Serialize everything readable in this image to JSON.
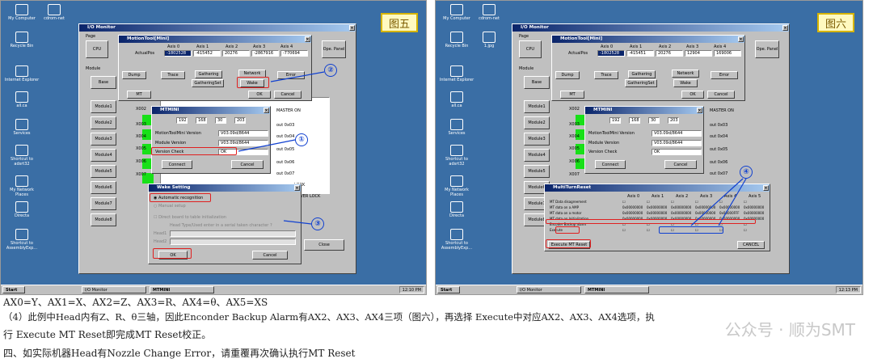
{
  "left": {
    "caption": "图五",
    "desktop": [
      "My Computer",
      "cdrom-net",
      "Recycle Bin",
      "Internet Explorer",
      "all.ca",
      "Services",
      "Shortcut to adsrt32",
      "My Network Places",
      "Directa",
      "Shortcut to AssemblyExp..."
    ],
    "io_title": "I/O Monitor",
    "page": "Page",
    "cpu": "CPU",
    "module": "Module",
    "base": "Base",
    "modules": [
      "Module1",
      "Module2",
      "Module3",
      "Module4",
      "Module5",
      "Module6",
      "Module7",
      "Module8"
    ],
    "mt_title": "MotionTool[Mini]",
    "axis_headers": [
      "Axis 0",
      "Axis 1",
      "Axis 2",
      "Axis 3",
      "Axis 4"
    ],
    "actualpos": "ActualPos",
    "actual_values": [
      "-1802528",
      "-415452",
      "20276",
      "-2867916",
      "-770694"
    ],
    "open_panel": "Ope. Panel",
    "dump": "Dump",
    "trace": "Trace",
    "gathering": "Gathering",
    "gathering_set": "GatheringSet",
    "network": "Network",
    "wake": "Wake",
    "error": "Error",
    "mt": "MT",
    "ok": "OK",
    "cancel": "Cancel",
    "mtmini": "MTMINI",
    "ip": [
      "192",
      "168",
      "30",
      "203"
    ],
    "ver_label": "MotionToolMini Version",
    "ver_val": "V03.09d/8644",
    "modver_label": "Module Version",
    "modver_val": "V03.09d/8644",
    "verchk_label": "Version Check",
    "verchk_val": "OK",
    "connect": "Connect",
    "ids": [
      "X002",
      "X003",
      "X004",
      "X005",
      "X006",
      "X007"
    ],
    "right_items": [
      "MASTER ON",
      "out 0x03",
      "out 0x04",
      "out 0x05",
      "out 0x06",
      "out 0x07",
      "LOCK",
      "COVER LOCK"
    ],
    "ws_title": "Wake Setting",
    "auto": "Automatic recognition",
    "manual": "Manual setup",
    "direct": "Direct board to table initialization",
    "head_prompt": "Head Type/Used enter in a serial taken character ?",
    "head1": "Head1",
    "head2": "Head2",
    "close": "Close",
    "start": "Start",
    "task_io": "I/O Monitor",
    "task_mt": "MTMINI",
    "clock": "12:10 PM",
    "marks": [
      "①",
      "②",
      "③"
    ]
  },
  "right": {
    "caption": "图六",
    "desktop": [
      "My Computer",
      "cdrom-net",
      "Recycle Bin",
      "1.jpg",
      "Internet Explorer",
      "all.ca",
      "Services",
      "Shortcut to adsrt32",
      "My Network Places",
      "Directa",
      "Shortcut to AssemblyExp..."
    ],
    "io_title": "I/O Monitor",
    "actual_values": [
      "-1802528",
      "-415451",
      "20276",
      "12904",
      "169006"
    ],
    "ip": [
      "192",
      "168",
      "30",
      "203"
    ],
    "ids": [
      "X002",
      "X003",
      "X004",
      "X005",
      "X006",
      "X007"
    ],
    "right_items": [
      "MASTER ON",
      "out 0x03",
      "out 0x04",
      "out 0x05",
      "out 0x06",
      "out 0x07"
    ],
    "mr_title": "MultiTurnReset",
    "mr_axes": [
      "Axis 0",
      "Axis 1",
      "Axis 2",
      "Axis 3",
      "Axis 4",
      "Axis 5"
    ],
    "mr_rows": [
      {
        "label": "MT Data disagreement",
        "vals": [
          "",
          "",
          "",
          "",
          "",
          ""
        ]
      },
      {
        "label": "MT data on a AMP",
        "vals": [
          "0x00000000",
          "0x00000000",
          "0x00000000",
          "0x00000000",
          "0x00000000",
          "0x00000000"
        ]
      },
      {
        "label": "MT data on a motor",
        "vals": [
          "0x00000000",
          "0x00000000",
          "0x00000000",
          "0x00000000",
          "0x00000FFF",
          "0x00000000"
        ]
      },
      {
        "label": "MT data on Initialization",
        "vals": [
          "0x00000000",
          "0x00000000",
          "0x00000000",
          "0x00000000",
          "0x00000000",
          "0x00000000"
        ]
      },
      {
        "label": "Encoder Backup alarm",
        "vals": [
          "",
          "",
          "",
          "",
          "",
          ""
        ]
      },
      {
        "label": "Execute",
        "vals": [
          "",
          "",
          "",
          "",
          "",
          ""
        ]
      }
    ],
    "exec_reset": "Execute MT Reset",
    "cancel_btn": "CANCEL",
    "clock": "12:13 PM",
    "mark": "④"
  },
  "lines": [
    "AX0=Y、AX1=X、AX2=Z、AX3=R、AX4=θ、AX5=XS",
    "（4）此例中Head内有Z、R、θ三轴，因此Enconder Backup Alarm有AX2、AX3、AX4三项（图六），再选择 Execute中对应AX2、AX3、AX4选项，执",
    "行 Execute MT Reset即完成MT Reset校正。",
    "四、如实际机器Head有Nozzle Change Error，请重覆再次确认执行MT Reset"
  ],
  "watermark": "公众号 · 顺为SMT"
}
